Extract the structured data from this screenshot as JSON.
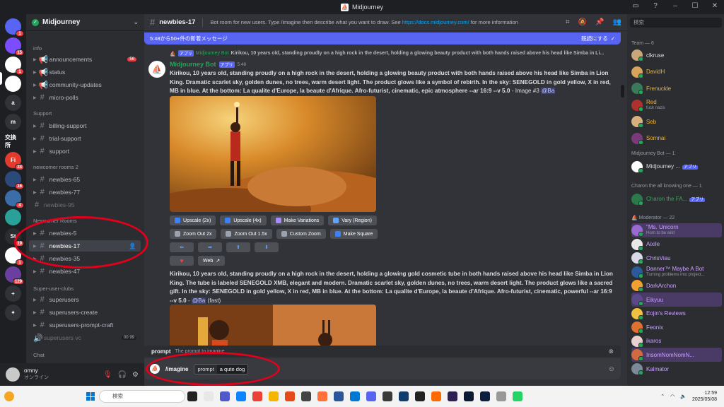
{
  "window": {
    "title": "Midjourney"
  },
  "rail": {
    "servers": [
      {
        "icon": "discord-icon",
        "label": "",
        "badge": "1",
        "color": "#5865f2"
      },
      {
        "icon": "server-icon",
        "label": "",
        "badge": "15",
        "color": "#7b4dff"
      },
      {
        "icon": "midjourney-icon",
        "label": "",
        "badge": "1",
        "color": "#ffffff"
      },
      {
        "icon": "server-icon",
        "label": "",
        "badge": "",
        "color": "#ffffff"
      },
      {
        "icon": "server-icon",
        "label": "a",
        "badge": "",
        "color": "#313338"
      },
      {
        "icon": "server-icon",
        "label": "m",
        "badge": "",
        "color": "#313338"
      },
      {
        "icon": "server-icon",
        "label": "交換所",
        "badge": "",
        "color": "#1e1f22"
      },
      {
        "icon": "server-icon",
        "label": "Fi",
        "badge": "24",
        "color": "#e23b2e"
      },
      {
        "icon": "server-icon",
        "label": "",
        "badge": "16",
        "color": "#2a4a7a"
      },
      {
        "icon": "server-icon",
        "label": "",
        "badge": "4",
        "color": "#3b6ea8"
      },
      {
        "icon": "server-icon",
        "label": "",
        "badge": "",
        "color": "#2aa198"
      },
      {
        "icon": "server-icon",
        "label": "St",
        "badge": "19",
        "color": "#2b2d31"
      },
      {
        "icon": "server-icon",
        "label": "",
        "badge": "1",
        "color": "#ffffff"
      },
      {
        "icon": "server-icon",
        "label": "",
        "badge": "129",
        "color": "#6a3fa0"
      },
      {
        "icon": "add-server-icon",
        "label": "+",
        "badge": "",
        "color": "#313338"
      },
      {
        "icon": "compass-icon",
        "label": "✦",
        "badge": "",
        "color": "#313338"
      }
    ]
  },
  "sidebar": {
    "server_name": "Midjourney",
    "categories": {
      "info": "info",
      "support": "Support",
      "newcomer2": "newcomer rooms 2",
      "newcomer": "Newcomer Rooms",
      "superuser": "Super-user-clubs",
      "chat": "Chat"
    },
    "channels": {
      "announcements": "announcements",
      "announcements_count": "56",
      "status": "status",
      "community_updates": "community-updates",
      "micro_polls": "micro-polls",
      "billing_support": "billing-support",
      "trial_support": "trial-support",
      "support": "support",
      "newbies_65": "newbies-65",
      "newbies_77": "newbies-77",
      "newbies_95": "newbies-95",
      "newbies_5": "newbies-5",
      "newbies_17": "newbies-17",
      "newbies_35": "newbies-35",
      "newbies_47": "newbies-47",
      "superusers": "superusers",
      "superusers_create": "superusers-create",
      "superusers_prompt_craft": "superusers-prompt-craft",
      "superusers_vc": "superusers vc",
      "superusers_vc_count1": "00",
      "superusers_vc_count2": "99"
    }
  },
  "user_panel": {
    "name": "omny",
    "status": "オンライン"
  },
  "header": {
    "channel": "newbies-17",
    "topic_prefix": "Bot room for new users. Type /imagine then describe what you want to draw. See",
    "topic_link": "https://docs.midjourney.com/",
    "topic_suffix": "for more information"
  },
  "new_messages": {
    "text": "5:48から50+件の新着メッセージ",
    "mark_read": "既読にする"
  },
  "messages": {
    "reply_app": "アプリ",
    "reply_author": "Midjourney Bot",
    "reply_text": "Kirikou, 10 years old, standing proudly on a high rock in the desert, holding a glowing beauty product with both hands raised above his head like Simba in Li...",
    "bot_name": "Midjourney Bot",
    "bot_tag": "アプリ",
    "time": "5:48",
    "prompt1": "Kirikou, 10 years old, standing proudly on a high rock in the desert, holding a glowing beauty product with both hands raised above his head like Simba in Lion King. Dramatic scarlet sky, golden dunes, no trees, warm desert light. The product glows like a symbol of rebirth. In the sky: SENEGOLD in gold yellow, X in red, MB in blue. At the bottom: La qualite d'Europe, la beaute d'Afrique. Afro-futurist, cinematic, epic atmosphere --ar 16:9 --v 5.0",
    "prompt1_suffix": " - Image #3 ",
    "mention": "@Ba",
    "buttons_row1": [
      "Upscale (2x)",
      "Upscale (4x)",
      "Make Variations",
      "Vary (Region)"
    ],
    "buttons_row2": [
      "Zoom Out 2x",
      "Zoom Out 1.5x",
      "Custom Zoom",
      "Make Square"
    ],
    "arrows": [
      "⬅",
      "➡",
      "⬆",
      "⬇"
    ],
    "heart": "♥",
    "web": "Web",
    "prompt2": "Kirikou, 10 years old, standing proudly on a high rock in the desert, holding a glowing gold cosmetic tube in both hands raised above his head like Simba in Lion King. The tube is labeled SENEGOLD XMB, elegant and modern. Dramatic scarlet sky, golden dunes, no trees, warm desert light. The product glows like a sacred gift. In the sky: SENEGOLD in gold yellow, X in red, MB in blue. At the bottom: La qualite d'Europe, la beaute d'Afrique. Afro-futurist, cinematic, powerful --ar 16:9 --v 5.0",
    "prompt2_suffix": " - ",
    "prompt2_tail": " (fast)"
  },
  "composer": {
    "option_name": "prompt",
    "option_desc": "The prompt to imagine",
    "command": "/imagine",
    "field_key": "prompt",
    "field_value": "a qute dog"
  },
  "members": {
    "search_placeholder": "検索",
    "groups": {
      "team": "Team — 6",
      "bot": "Midjourney Bot — 1",
      "charon": "Charon the all knowing one — 1",
      "moderator": "Moderator — 22"
    },
    "team": [
      {
        "name": "clkruse",
        "sub": "",
        "color": "#dbdee1",
        "av": "#c8a87a"
      },
      {
        "name": "DavidH",
        "sub": "",
        "color": "#f0b232",
        "av": "#d9a35a"
      },
      {
        "name": "Frenuckle",
        "sub": "",
        "color": "#f0b232",
        "av": "#3a7a5a"
      },
      {
        "name": "Red",
        "sub": "fuck nazis",
        "color": "#f0b232",
        "av": "#b03030"
      },
      {
        "name": "Seb",
        "sub": "",
        "color": "#f0b232",
        "av": "#d8b080"
      },
      {
        "name": "Somnai",
        "sub": "",
        "color": "#f0b232",
        "av": "#7a3a7a"
      }
    ],
    "bot": {
      "name": "Midjourney ...",
      "tag": "アプリ"
    },
    "charon": {
      "name": "Charon the FA...",
      "tag": "アプリ"
    },
    "mods": [
      {
        "name": "\"Ms. Unicorn",
        "sub": "Horn to be wild",
        "color": "#c9a0ff",
        "av": "#9a6ad0",
        "hl": true
      },
      {
        "name": "Aixile",
        "sub": "",
        "color": "#c9a0ff",
        "av": "#e8e8e8",
        "hl": false
      },
      {
        "name": "ChrisViau",
        "sub": "",
        "color": "#c9a0ff",
        "av": "#d8d8e8",
        "hl": false
      },
      {
        "name": "Danner™ Maybe A Bot",
        "sub": "Turning problems into project...",
        "color": "#c9a0ff",
        "av": "#2a5a9a",
        "hl": false
      },
      {
        "name": "DarkArchon",
        "sub": "",
        "color": "#c9a0ff",
        "av": "#f0a030",
        "hl": false
      },
      {
        "name": "Eikyuu",
        "sub": "",
        "color": "#c9a0ff",
        "av": "#5a4a8a",
        "hl": true
      },
      {
        "name": "Eojin's Reviews",
        "sub": "",
        "color": "#c9a0ff",
        "av": "#f0c040",
        "hl": false
      },
      {
        "name": "Feonix",
        "sub": "",
        "color": "#c9a0ff",
        "av": "#e07030",
        "hl": false
      },
      {
        "name": "ikaros",
        "sub": "",
        "color": "#c9a0ff",
        "av": "#e8d0d0",
        "hl": false
      },
      {
        "name": "InsomNomNomN...",
        "sub": "",
        "color": "#c9a0ff",
        "av": "#d06a40",
        "hl": true
      },
      {
        "name": "Kalmator",
        "sub": "",
        "color": "#c9a0ff",
        "av": "#7a8a9a",
        "hl": false
      }
    ]
  },
  "taskbar": {
    "search": "検索",
    "time": "12:59",
    "date": "2025/05/08"
  }
}
